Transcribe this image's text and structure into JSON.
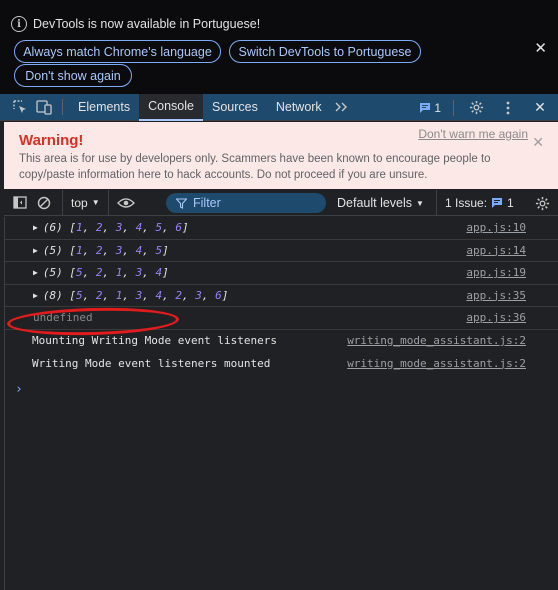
{
  "infobar": {
    "message": "DevTools is now available in Portuguese!",
    "buttons": [
      "Always match Chrome's language",
      "Switch DevTools to Portuguese",
      "Don't show again"
    ]
  },
  "toolbar": {
    "tabs": [
      "Elements",
      "Console",
      "Sources",
      "Network"
    ],
    "active_tab": "Console",
    "issues_count": "1"
  },
  "warning": {
    "title": "Warning!",
    "body": "This area is for use by developers only. Scammers have been known to encourage people to copy/paste information here to hack accounts. Do not proceed if you are unsure.",
    "dont_warn": "Don't warn me again"
  },
  "console_toolbar": {
    "context": "top",
    "filter_placeholder": "Filter",
    "levels": "Default levels",
    "issues_label": "1 Issue:",
    "issues_count": "1"
  },
  "logs": [
    {
      "type": "array",
      "length": "6",
      "items": [
        "1",
        "2",
        "3",
        "4",
        "5",
        "6"
      ],
      "source": "app.js:10"
    },
    {
      "type": "array",
      "length": "5",
      "items": [
        "1",
        "2",
        "3",
        "4",
        "5"
      ],
      "source": "app.js:14"
    },
    {
      "type": "array",
      "length": "5",
      "items": [
        "5",
        "2",
        "1",
        "3",
        "4"
      ],
      "source": "app.js:19"
    },
    {
      "type": "array",
      "length": "8",
      "items": [
        "5",
        "2",
        "1",
        "3",
        "4",
        "2",
        "3",
        "6"
      ],
      "source": "app.js:35"
    },
    {
      "type": "undefined",
      "text": "undefined",
      "source": "app.js:36"
    },
    {
      "type": "text",
      "text": "Mounting Writing Mode event listeners",
      "source": "writing_mode_assistant.js:2"
    },
    {
      "type": "text",
      "text": "Writing Mode event listeners mounted",
      "source": "writing_mode_assistant.js:2"
    }
  ],
  "prompt_symbol": "›",
  "colors": {
    "accent": "#a8c7fa",
    "toolbar_bg": "#1e4a6e",
    "warning_title": "#d93025",
    "number": "#9980ff",
    "annotation": "#e21c1c"
  }
}
